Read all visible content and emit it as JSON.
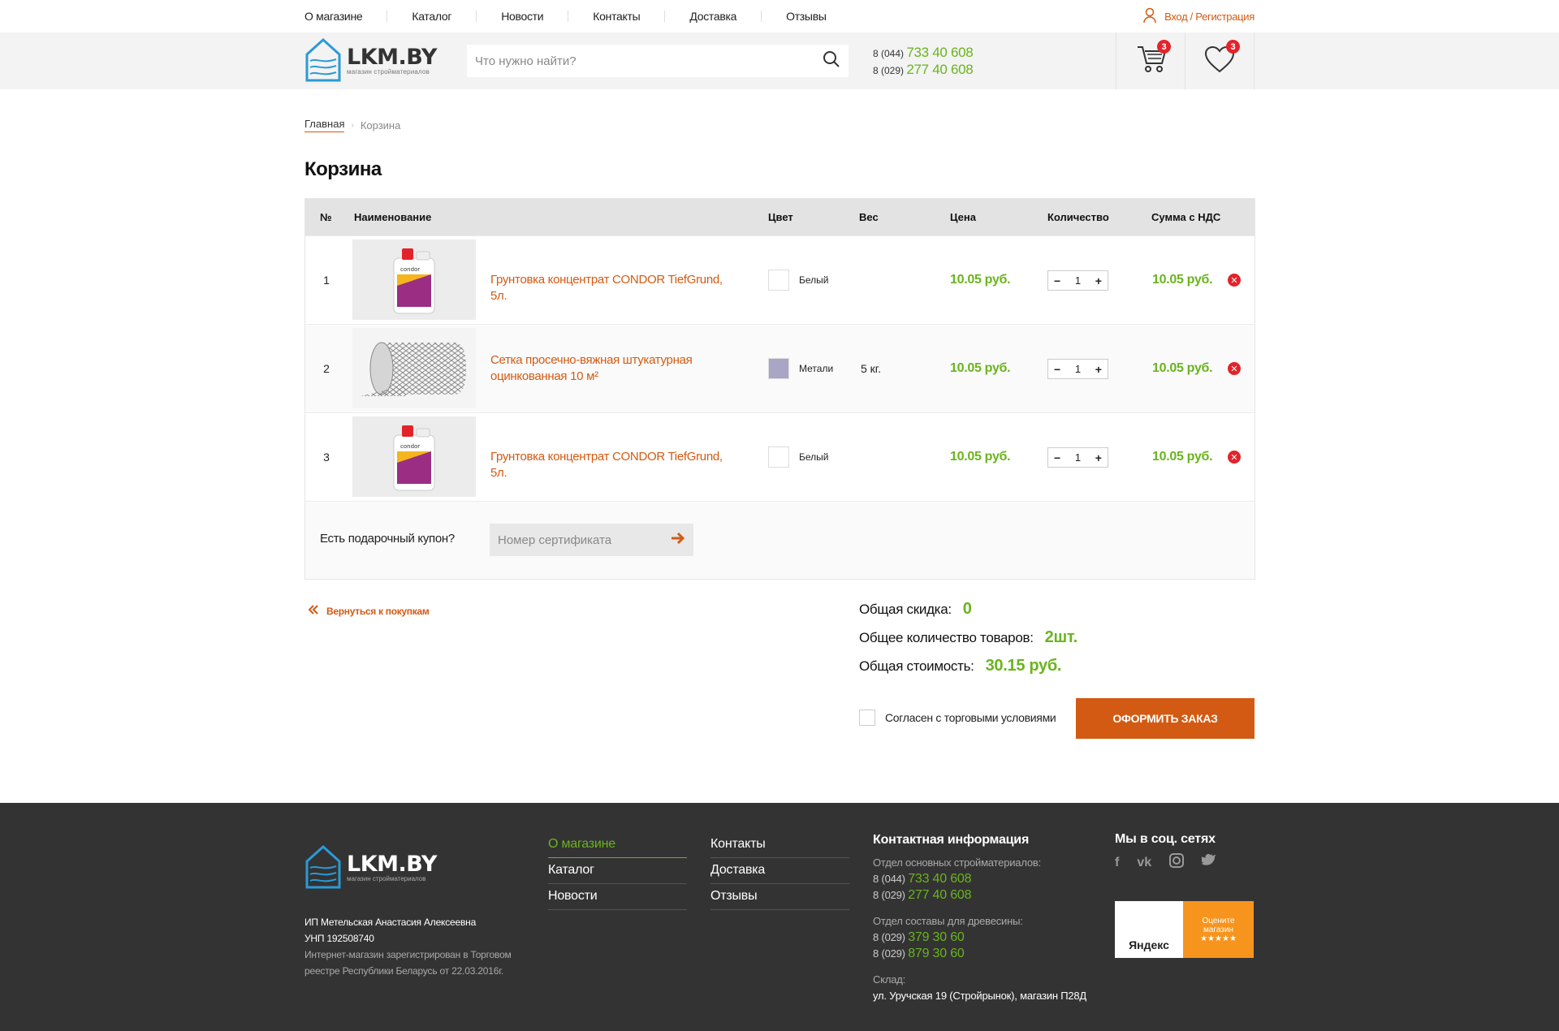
{
  "topnav": {
    "items": [
      "О магазине",
      "Каталог",
      "Новости",
      "Контакты",
      "Доставка",
      "Отзывы"
    ],
    "login": "Вход / Регистрация"
  },
  "header": {
    "logo_text": "LKM.BY",
    "logo_tagline": "магазин стройматериалов",
    "search_placeholder": "Что нужно найти?",
    "phones": [
      {
        "code": "8 (044)",
        "number": "733 40 608"
      },
      {
        "code": "8 (029)",
        "number": "277 40 608"
      }
    ],
    "cart_count": "3",
    "wishlist_count": "3"
  },
  "breadcrumb": {
    "home": "Главная",
    "current": "Корзина"
  },
  "page_title": "Корзина",
  "table": {
    "headers": [
      "№",
      "Наименование",
      "Цвет",
      "Вес",
      "Цена",
      "Количество",
      "Сумма с НДС"
    ],
    "rows": [
      {
        "num": "1",
        "name": "Грунтовка концентрат CONDOR TiefGrund, 5л.",
        "color_name": "Белый",
        "swatch": "#ffffff",
        "weight": "",
        "price": "10.05 руб.",
        "qty": "1",
        "sum": "10.05 руб."
      },
      {
        "num": "2",
        "name": "Сетка просечно-вяжная штукатурная оцинкованная 10 м²",
        "color_name": "Метали",
        "swatch": "#a9a5c4",
        "weight": "5 кг.",
        "price": "10.05 руб.",
        "qty": "1",
        "sum": "10.05 руб."
      },
      {
        "num": "3",
        "name": "Грунтовка концентрат CONDOR TiefGrund, 5л.",
        "color_name": "Белый",
        "swatch": "#ffffff",
        "weight": "",
        "price": "10.05 руб.",
        "qty": "1",
        "sum": "10.05 руб."
      }
    ]
  },
  "coupon": {
    "label": "Есть подарочный купон?",
    "placeholder": "Номер сертификата"
  },
  "back_link": "Вернуться к покупкам",
  "totals": {
    "discount_label": "Общая скидка:",
    "discount_value": "0",
    "count_label": "Общее количество товаров:",
    "count_value": "2шт.",
    "cost_label": "Общая стоимость:",
    "cost_value": "30.15 руб."
  },
  "agree_text": "Согласен с торговыми условиями",
  "order_button": "ОФОРМИТЬ ЗАКАЗ",
  "footer": {
    "logo_text": "LKM.BY",
    "logo_tagline": "магазин стройматериалов",
    "legal": {
      "owner": "ИП Метельская Анастасия Алексеевна",
      "unp": "УНП 192508740",
      "reg": "Интернет-магазин зарегистрирован в Торговом реестре Республики Беларусь от 22.03.2016г."
    },
    "menu1": [
      "О магазине",
      "Каталог",
      "Новости"
    ],
    "menu2": [
      "Контакты",
      "Доставка",
      "Отзывы"
    ],
    "contact_title": "Контактная информация",
    "dept1": "Отдел основных стройматериалов:",
    "dept1_phones": [
      {
        "code": "8 (044)",
        "number": "733 40 608"
      },
      {
        "code": "8 (029)",
        "number": "277 40 608"
      }
    ],
    "dept2": "Отдел составы для древесины:",
    "dept2_phones": [
      {
        "code": "8 (029)",
        "number": "379 30 60"
      },
      {
        "code": "8 (029)",
        "number": "879 30 60"
      }
    ],
    "warehouse_label": "Склад:",
    "warehouse_address": "ул. Уручская 19 (Стройрынок), магазин П28Д",
    "social_title": "Мы в соц. сетях",
    "yandex_left": "Яндекс",
    "yandex_right_1": "Оцените",
    "yandex_right_2": "магазин",
    "yandex_stars": "★★★★★"
  },
  "colors": {
    "accent": "#d35a12",
    "green": "#6ab41e",
    "footer_bg": "#333333"
  }
}
